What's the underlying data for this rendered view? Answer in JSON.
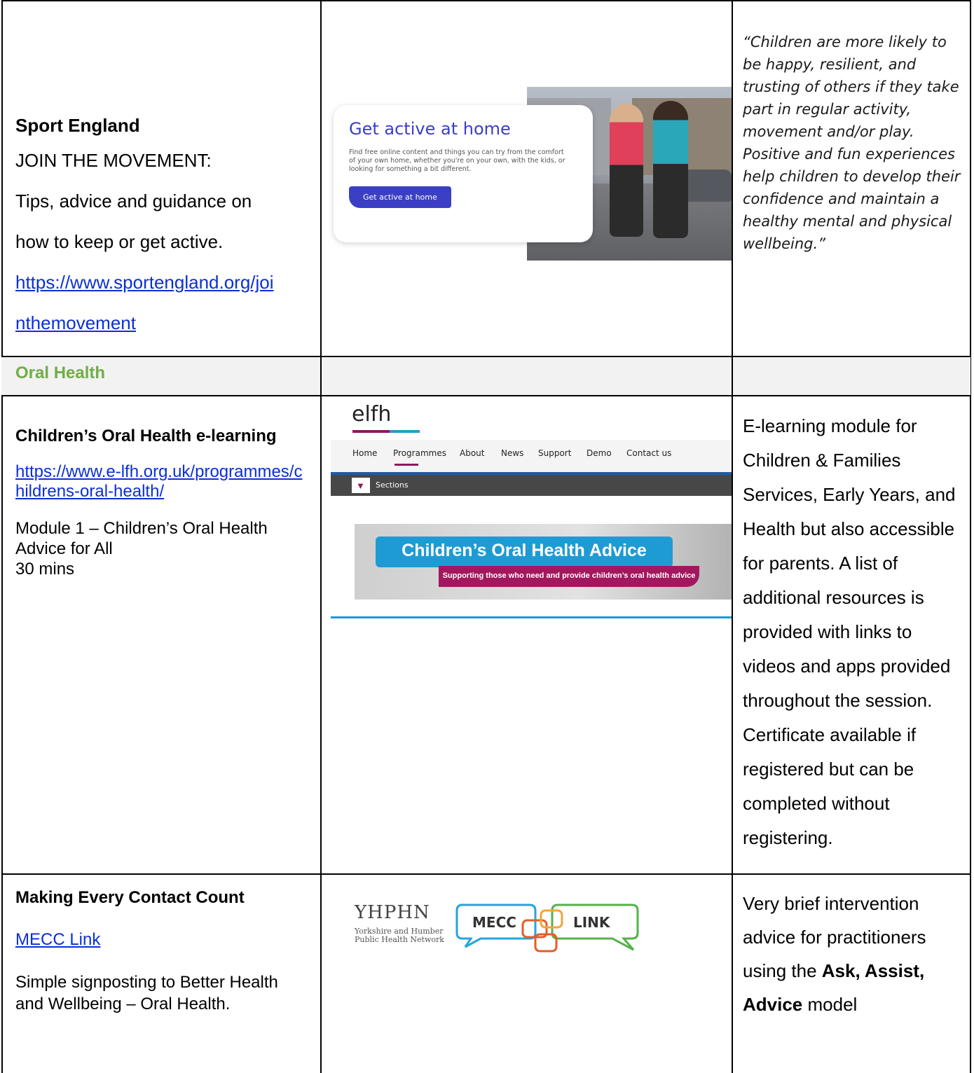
{
  "row1": {
    "org": "Sport England",
    "lines": [
      "JOIN THE MOVEMENT:",
      "Tips, advice and guidance on",
      "how to keep or get active."
    ],
    "url_line1": "https://www.sportengland.org/joi",
    "url_line2": "nthemovement",
    "image": {
      "heading": "Get active at home",
      "body": "Find free online content and things you can try from the comfort of your own home, whether you're on your own, with the kids, or looking for something a bit different.",
      "button": "Get active at home"
    },
    "quote": "“Children are more likely to be happy, resilient, and trusting of others if they take part in regular activity, movement and/or play. Positive and fun experiences help children to develop their confidence and maintain a healthy mental and physical wellbeing.”"
  },
  "section": {
    "title": "Oral Health"
  },
  "row3": {
    "title": "Children’s Oral Health e-learning",
    "url": "https://www.e-lfh.org.uk/programmes/childrens-oral-health/",
    "module": "Module 1 – Children’s Oral Health Advice for All",
    "duration": "30 mins",
    "image": {
      "logo": "elfh",
      "nav": [
        "Home",
        "Programmes",
        "About",
        "News",
        "Support",
        "Demo",
        "Contact us"
      ],
      "sections_label": "Sections",
      "banner_title": "Children’s Oral Health Advice",
      "banner_sub": "Supporting those who need and provide children’s oral health advice"
    },
    "description": "E-learning module for Children & Families Services, Early Years, and Health but also accessible for parents. A list of additional resources is provided with links to videos and apps provided throughout the session. Certificate available if registered but can be completed without registering."
  },
  "row4": {
    "title": "Making Every Contact Count",
    "link": "MECC Link",
    "text": "Simple signposting to Better Health and Wellbeing – Oral Health.",
    "logo": {
      "name": "YHPHN",
      "sub_line1": "Yorkshire and Humber",
      "sub_line2": "Public Health Network",
      "bubble1": "MECC",
      "bubble2": "LINK"
    },
    "desc_prefix": "Very brief intervention advice for practitioners using the ",
    "desc_bold": "Ask, Assist, Advice",
    "desc_suffix": " model"
  },
  "colors": {
    "link": "#0b2fd6",
    "section_green": "#70ad47",
    "band_grey": "#f2f2f2",
    "sport_blue": "#3b3fc4",
    "elfh_magenta": "#a3175e",
    "elfh_blue": "#1f9bd3"
  }
}
